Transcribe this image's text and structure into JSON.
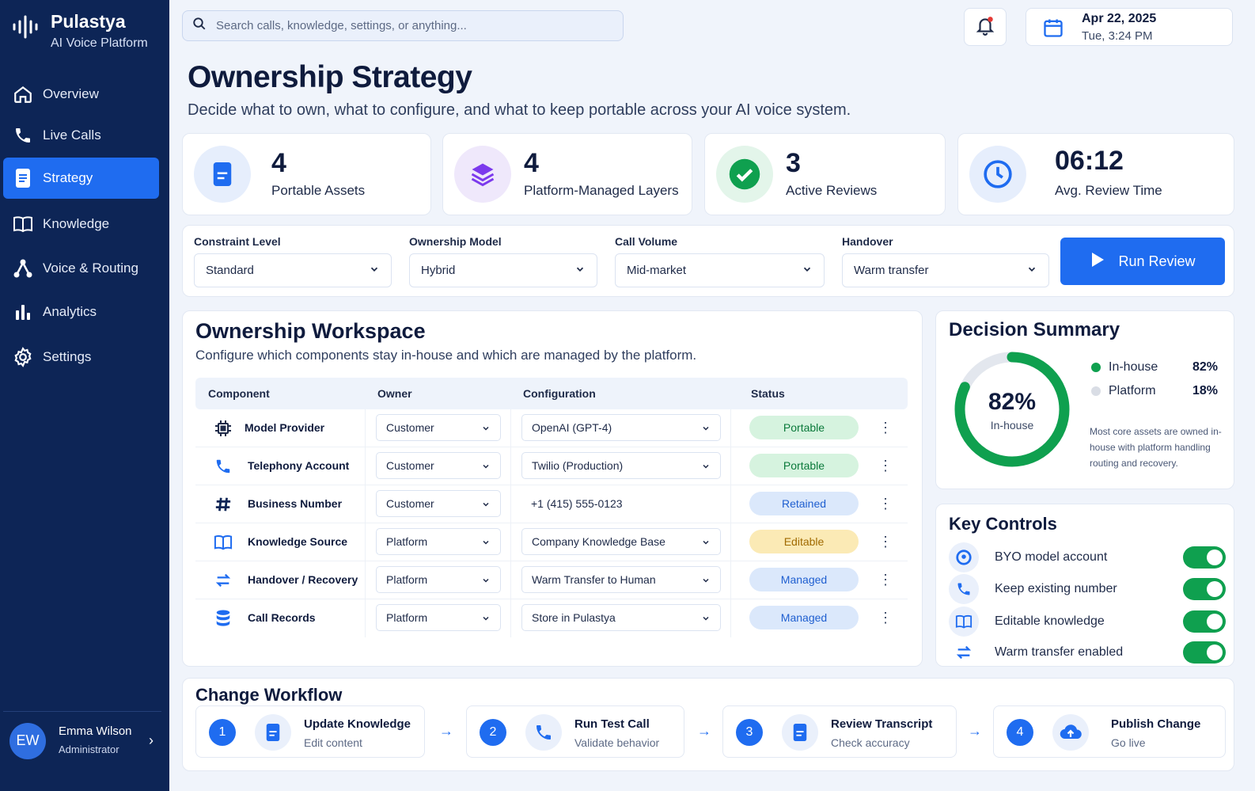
{
  "app": {
    "name": "Pulastya",
    "subtitle": "AI Voice Platform"
  },
  "nav": [
    {
      "label": "Overview",
      "icon": "home-icon",
      "active": false
    },
    {
      "label": "Live Calls",
      "icon": "phone-icon",
      "active": false
    },
    {
      "label": "Strategy",
      "icon": "document-icon",
      "active": true
    },
    {
      "label": "Knowledge",
      "icon": "book-icon",
      "active": false
    },
    {
      "label": "Voice & Routing",
      "icon": "routing-icon",
      "active": false
    },
    {
      "label": "Analytics",
      "icon": "bar-chart-icon",
      "active": false
    },
    {
      "label": "Settings",
      "icon": "gear-icon",
      "active": false
    }
  ],
  "user": {
    "initials": "EW",
    "name": "Emma Wilson",
    "role": "Administrator"
  },
  "search": {
    "placeholder": "Search calls, knowledge, settings, or anything..."
  },
  "date": {
    "main": "Apr 22, 2025",
    "sub": "Tue, 3:24 PM"
  },
  "page": {
    "title": "Ownership Strategy",
    "subtitle": "Decide what to own, what to configure, and what to keep portable across your AI voice system."
  },
  "stats": [
    {
      "value": "4",
      "label": "Portable Assets",
      "icon": "document-icon"
    },
    {
      "value": "4",
      "label": "Platform-Managed Layers",
      "icon": "layers-icon"
    },
    {
      "value": "3",
      "label": "Active Reviews",
      "icon": "check-icon"
    },
    {
      "value": "06:12",
      "label": "Avg. Review Time",
      "icon": "clock-icon"
    }
  ],
  "filters": [
    {
      "label": "Constraint Level",
      "value": "Standard"
    },
    {
      "label": "Ownership Model",
      "value": "Hybrid"
    },
    {
      "label": "Call Volume",
      "value": "Mid-market"
    },
    {
      "label": "Handover",
      "value": "Warm transfer"
    }
  ],
  "run_button": "Run Review",
  "workspace": {
    "title": "Ownership Workspace",
    "subtitle": "Configure which components stay in-house and which are managed by the platform.",
    "columns": [
      "Component",
      "Owner",
      "Configuration",
      "Status"
    ],
    "rows": [
      {
        "component": "Model Provider",
        "icon": "chip-icon",
        "owner": "Customer",
        "config": "OpenAI (GPT-4)",
        "config_select": true,
        "status": "Portable",
        "status_type": "green"
      },
      {
        "component": "Telephony Account",
        "icon": "phone-icon",
        "owner": "Customer",
        "config": "Twilio (Production)",
        "config_select": true,
        "status": "Portable",
        "status_type": "green"
      },
      {
        "component": "Business Number",
        "icon": "hash-icon",
        "owner": "Customer",
        "config": "+1 (415) 555-0123",
        "config_select": false,
        "status": "Retained",
        "status_type": "blue"
      },
      {
        "component": "Knowledge Source",
        "icon": "book-icon",
        "owner": "Platform",
        "config": "Company Knowledge Base",
        "config_select": true,
        "status": "Editable",
        "status_type": "yellow"
      },
      {
        "component": "Handover / Recovery",
        "icon": "transfer-icon",
        "owner": "Platform",
        "config": "Warm Transfer to Human",
        "config_select": true,
        "status": "Managed",
        "status_type": "blue"
      },
      {
        "component": "Call Records",
        "icon": "database-icon",
        "owner": "Platform",
        "config": "Store in Pulastya",
        "config_select": true,
        "status": "Managed",
        "status_type": "blue"
      }
    ]
  },
  "decision": {
    "title": "Decision Summary",
    "percent": "82%",
    "percent_fraction": 0.82,
    "center_label": "In-house",
    "legend": [
      {
        "label": "In-house",
        "value": "82%",
        "color": "#0fa04f"
      },
      {
        "label": "Platform",
        "value": "18%",
        "color": "#d9dde5"
      }
    ],
    "note": "Most core assets are owned in-house with platform handling routing and recovery."
  },
  "key_controls": {
    "title": "Key Controls",
    "items": [
      {
        "label": "BYO model account",
        "icon": "model-icon",
        "on": true
      },
      {
        "label": "Keep existing number",
        "icon": "phone-icon",
        "on": true
      },
      {
        "label": "Editable knowledge",
        "icon": "book-icon",
        "on": true
      },
      {
        "label": "Warm transfer enabled",
        "icon": "transfer-icon",
        "on": true
      }
    ]
  },
  "workflow": {
    "title": "Change Workflow",
    "steps": [
      {
        "num": "1",
        "title": "Update Knowledge",
        "sub": "Edit content",
        "icon": "document-icon"
      },
      {
        "num": "2",
        "title": "Run Test Call",
        "sub": "Validate behavior",
        "icon": "phone-icon"
      },
      {
        "num": "3",
        "title": "Review Transcript",
        "sub": "Check accuracy",
        "icon": "document-icon"
      },
      {
        "num": "4",
        "title": "Publish Change",
        "sub": "Go live",
        "icon": "cloud-upload-icon"
      }
    ]
  },
  "colors": {
    "accent": "#1f6cf0",
    "success": "#0fa04f",
    "sidebar": "#0d2556"
  }
}
